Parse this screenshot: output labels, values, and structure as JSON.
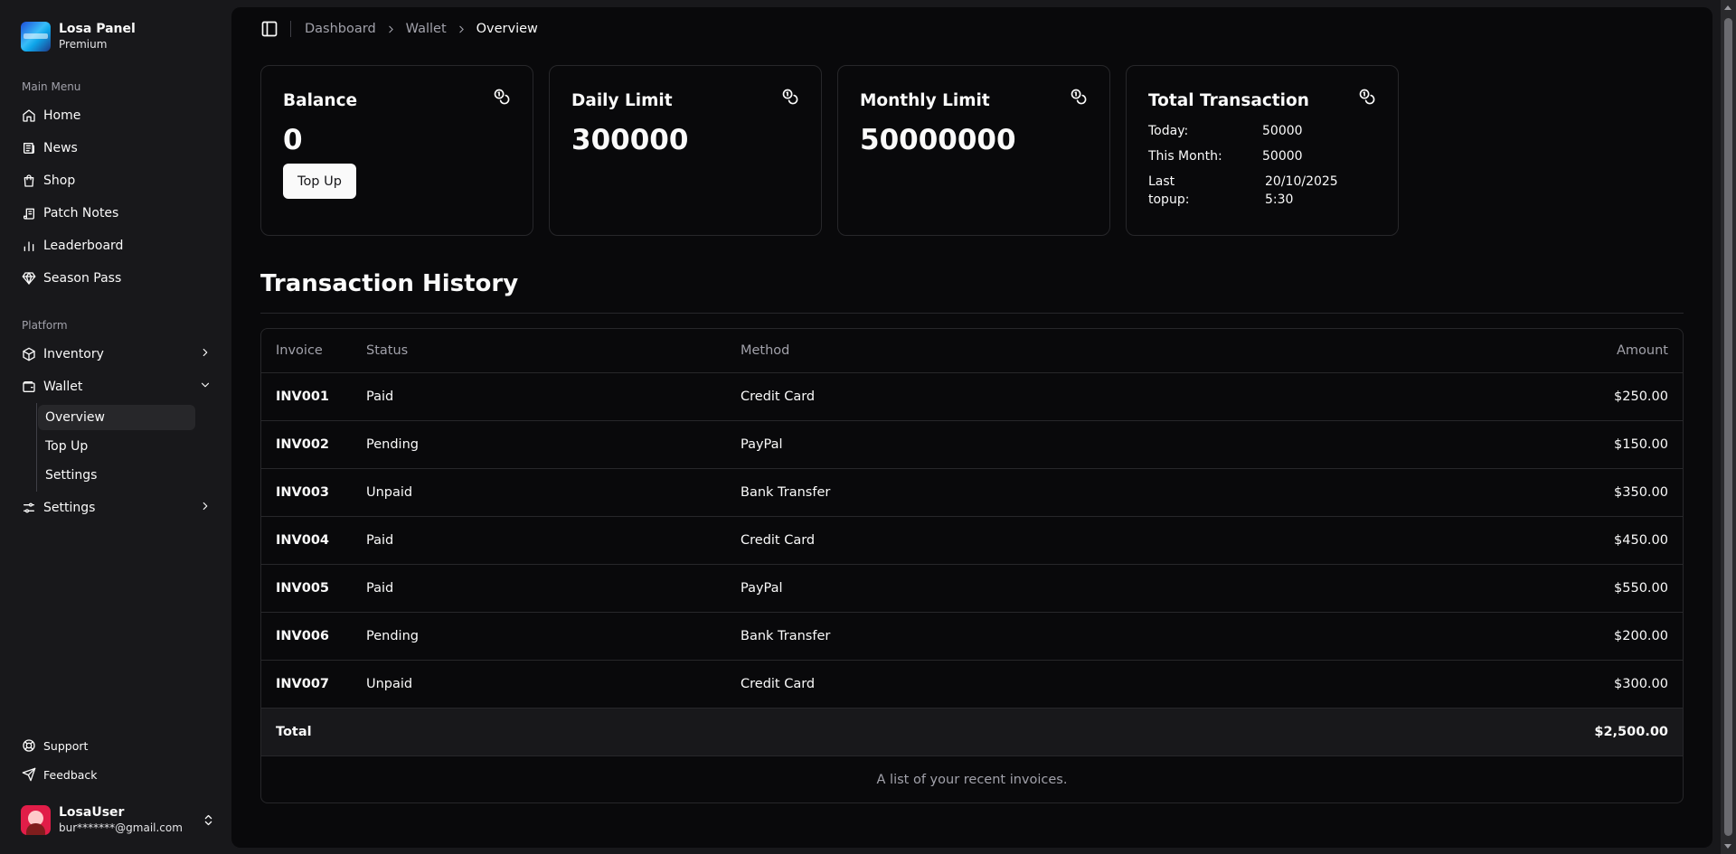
{
  "brand": {
    "name": "Losa Panel",
    "plan": "Premium"
  },
  "sidebar": {
    "main_menu_label": "Main Menu",
    "main_items": [
      {
        "label": "Home",
        "icon": "home-icon"
      },
      {
        "label": "News",
        "icon": "newspaper-icon"
      },
      {
        "label": "Shop",
        "icon": "shopping-bag-icon"
      },
      {
        "label": "Patch Notes",
        "icon": "scroll-icon"
      },
      {
        "label": "Leaderboard",
        "icon": "bar-chart-icon"
      },
      {
        "label": "Season Pass",
        "icon": "gem-icon"
      }
    ],
    "platform_label": "Platform",
    "platform_items": {
      "inventory": "Inventory",
      "wallet": "Wallet",
      "wallet_sub": [
        "Overview",
        "Top Up",
        "Settings"
      ],
      "settings": "Settings"
    },
    "footer_items": {
      "support": "Support",
      "feedback": "Feedback"
    },
    "user": {
      "name": "LosaUser",
      "email": "bur*******@gmail.com"
    }
  },
  "breadcrumb": [
    "Dashboard",
    "Wallet",
    "Overview"
  ],
  "cards": {
    "balance": {
      "title": "Balance",
      "value": "0",
      "button": "Top Up"
    },
    "daily": {
      "title": "Daily Limit",
      "value": "300000"
    },
    "monthly": {
      "title": "Monthly Limit",
      "value": "50000000"
    },
    "total": {
      "title": "Total Transaction",
      "today_label": "Today:",
      "today_value": "50000",
      "month_label": "This Month:",
      "month_value": "50000",
      "last_label_1": "Last",
      "last_label_2": "topup:",
      "last_value_1": "20/10/2025",
      "last_value_2": "5:30"
    }
  },
  "history": {
    "title": "Transaction History",
    "columns": [
      "Invoice",
      "Status",
      "Method",
      "Amount"
    ],
    "rows": [
      [
        "INV001",
        "Paid",
        "Credit Card",
        "$250.00"
      ],
      [
        "INV002",
        "Pending",
        "PayPal",
        "$150.00"
      ],
      [
        "INV003",
        "Unpaid",
        "Bank Transfer",
        "$350.00"
      ],
      [
        "INV004",
        "Paid",
        "Credit Card",
        "$450.00"
      ],
      [
        "INV005",
        "Paid",
        "PayPal",
        "$550.00"
      ],
      [
        "INV006",
        "Pending",
        "Bank Transfer",
        "$200.00"
      ],
      [
        "INV007",
        "Unpaid",
        "Credit Card",
        "$300.00"
      ]
    ],
    "total_label": "Total",
    "total_value": "$2,500.00",
    "caption": "A list of your recent invoices."
  },
  "colors": {
    "background": "#18181b",
    "panel": "#09090b",
    "border": "#27272a",
    "muted": "#a1a1aa",
    "text": "#fafafa"
  }
}
